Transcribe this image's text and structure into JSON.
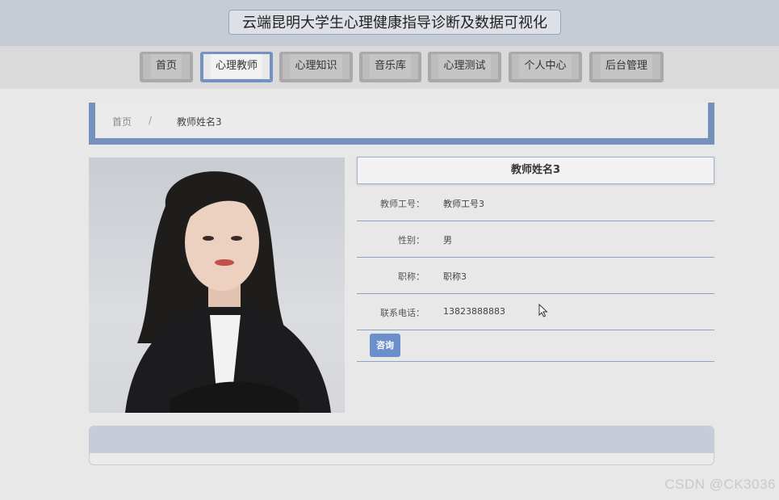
{
  "header": {
    "title": "云端昆明大学生心理健康指导诊断及数据可视化"
  },
  "nav": {
    "items": [
      {
        "label": "首页",
        "active": false
      },
      {
        "label": "心理教师",
        "active": true
      },
      {
        "label": "心理知识",
        "active": false
      },
      {
        "label": "音乐库",
        "active": false
      },
      {
        "label": "心理测试",
        "active": false
      },
      {
        "label": "个人中心",
        "active": false
      },
      {
        "label": "后台管理",
        "active": false
      }
    ]
  },
  "breadcrumb": {
    "home": "首页",
    "separator": "/",
    "current": "教师姓名3"
  },
  "teacher": {
    "name": "教师姓名3",
    "fields": [
      {
        "label": "教师工号：",
        "value": "教师工号3"
      },
      {
        "label": "性别：",
        "value": "男"
      },
      {
        "label": "职称：",
        "value": "职称3"
      },
      {
        "label": "联系电话：",
        "value": "13823888883"
      }
    ],
    "consult_label": "咨询"
  },
  "watermark": "CSDN @CK3036",
  "colors": {
    "accent": "#7591bd",
    "button": "#6b8fcb",
    "header_bg": "#c6ccd6"
  }
}
